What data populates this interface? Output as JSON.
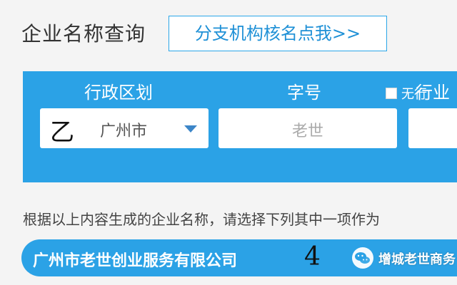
{
  "header": {
    "title": "企业名称查询",
    "branch_link": "分支机构核名点我>>"
  },
  "form": {
    "labels": {
      "region": "行政区划",
      "name": "字号",
      "industry": "行业"
    },
    "region_value": "广州市",
    "handwritten_mark": "乙",
    "name_placeholder": "老世",
    "checkbox_label": "无行"
  },
  "instruction": "根据以上内容生成的企业名称，请选择下列其中一项作为",
  "results": {
    "items": [
      {
        "name": "广州市老世创业服务有限公司",
        "handwritten_number": "4"
      }
    ]
  },
  "watermark": "增城老世商务",
  "colors": {
    "accent": "#2ba2e6",
    "link": "#1e90d6",
    "chevron": "#3c86c8",
    "background": "#f4f4f4"
  },
  "icons": {
    "region_dropdown": "chevron-down-icon",
    "watermark": "wechat-icon"
  }
}
